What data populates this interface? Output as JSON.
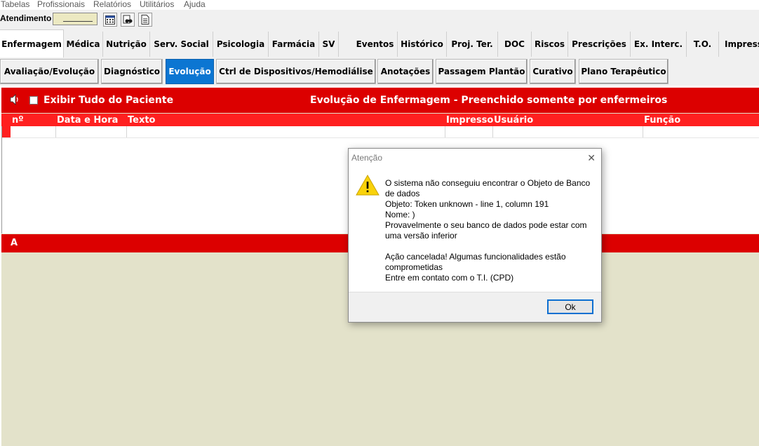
{
  "menu": [
    "Tabelas",
    "Profissionais",
    "Relatórios",
    "Utilitários",
    "Ajuda"
  ],
  "toolbar": {
    "label": "Atendimento",
    "field_value": "",
    "icons": [
      "calendar-icon",
      "binoculars-icon",
      "document-icon"
    ]
  },
  "tabs_main": [
    "Enfermagem",
    "Médica",
    "Nutrição",
    "Serv. Social",
    "Psicologia",
    "Farmácia",
    "SV",
    "Eventos",
    "Histórico",
    "Proj. Ter.",
    "DOC",
    "Riscos",
    "Prescrições",
    "Ex. Interc.",
    "T.O.",
    "Impress"
  ],
  "tabs_main_active": "Enfermagem",
  "tabs_sub": [
    "Avaliação/Evolução",
    "Diagnóstico",
    "Evolução",
    "Ctrl de Dispositivos/Hemodiálise",
    "Anotações",
    "Passagem Plantão",
    "Curativo",
    "Plano Terapêutico"
  ],
  "tabs_sub_active": "Evolução",
  "panel": {
    "checkbox_label": "Exibir Tudo do Paciente",
    "checkbox_checked": false,
    "title": "Evolução de Enfermagem - Preenchido somente por enfermeiros",
    "columns": [
      "nº",
      "Data e Hora",
      "Texto",
      "Impresso",
      "Usuário",
      "Função"
    ],
    "section_b_label": "A"
  },
  "dialog": {
    "title": "Atenção",
    "message_lines": [
      "O sistema não conseguiu encontrar o Objeto de Banco",
      "de dados",
      "Objeto: Token unknown - line 1, column 191",
      "Nome: )",
      "Provavelmente o seu banco de dados pode estar com",
      "uma versão inferior",
      "",
      "Ação cancelada! Algumas funcionalidades estão",
      "comprometidas",
      "Entre em contato com o T.I. (CPD)"
    ],
    "ok_label": "Ok"
  },
  "colors": {
    "header_red": "#dc0000",
    "column_red": "#ff2020",
    "active_tab_blue": "#0c76d2",
    "panel_background": "#e3e2ca"
  }
}
